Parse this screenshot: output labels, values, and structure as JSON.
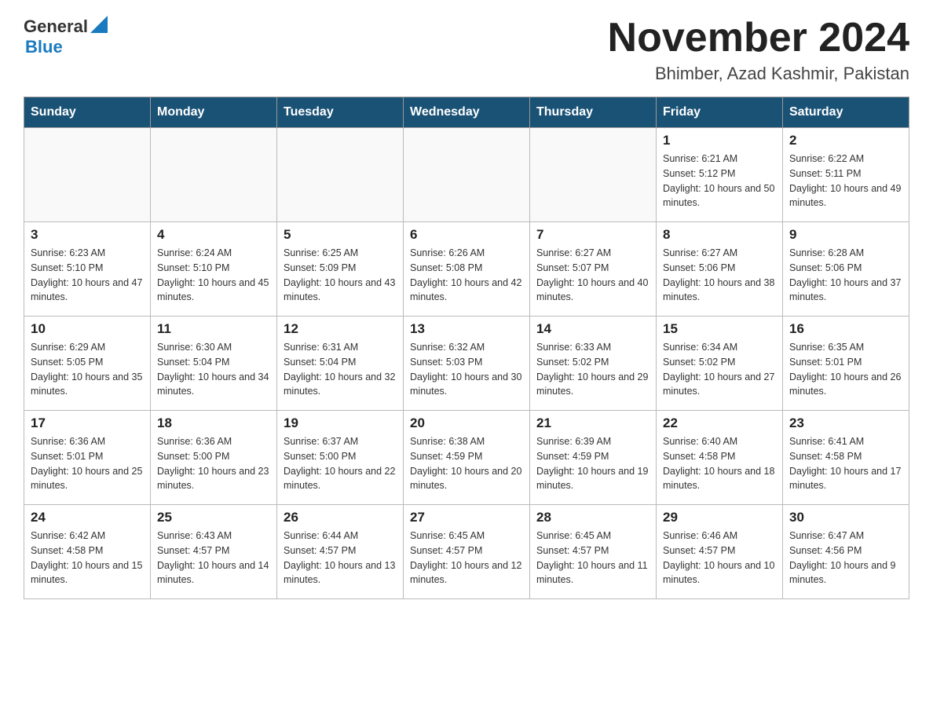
{
  "header": {
    "logo": {
      "general": "General",
      "blue": "Blue"
    },
    "title": "November 2024",
    "subtitle": "Bhimber, Azad Kashmir, Pakistan"
  },
  "days_of_week": [
    "Sunday",
    "Monday",
    "Tuesday",
    "Wednesday",
    "Thursday",
    "Friday",
    "Saturday"
  ],
  "weeks": [
    [
      {
        "day": "",
        "info": ""
      },
      {
        "day": "",
        "info": ""
      },
      {
        "day": "",
        "info": ""
      },
      {
        "day": "",
        "info": ""
      },
      {
        "day": "",
        "info": ""
      },
      {
        "day": "1",
        "info": "Sunrise: 6:21 AM\nSunset: 5:12 PM\nDaylight: 10 hours and 50 minutes."
      },
      {
        "day": "2",
        "info": "Sunrise: 6:22 AM\nSunset: 5:11 PM\nDaylight: 10 hours and 49 minutes."
      }
    ],
    [
      {
        "day": "3",
        "info": "Sunrise: 6:23 AM\nSunset: 5:10 PM\nDaylight: 10 hours and 47 minutes."
      },
      {
        "day": "4",
        "info": "Sunrise: 6:24 AM\nSunset: 5:10 PM\nDaylight: 10 hours and 45 minutes."
      },
      {
        "day": "5",
        "info": "Sunrise: 6:25 AM\nSunset: 5:09 PM\nDaylight: 10 hours and 43 minutes."
      },
      {
        "day": "6",
        "info": "Sunrise: 6:26 AM\nSunset: 5:08 PM\nDaylight: 10 hours and 42 minutes."
      },
      {
        "day": "7",
        "info": "Sunrise: 6:27 AM\nSunset: 5:07 PM\nDaylight: 10 hours and 40 minutes."
      },
      {
        "day": "8",
        "info": "Sunrise: 6:27 AM\nSunset: 5:06 PM\nDaylight: 10 hours and 38 minutes."
      },
      {
        "day": "9",
        "info": "Sunrise: 6:28 AM\nSunset: 5:06 PM\nDaylight: 10 hours and 37 minutes."
      }
    ],
    [
      {
        "day": "10",
        "info": "Sunrise: 6:29 AM\nSunset: 5:05 PM\nDaylight: 10 hours and 35 minutes."
      },
      {
        "day": "11",
        "info": "Sunrise: 6:30 AM\nSunset: 5:04 PM\nDaylight: 10 hours and 34 minutes."
      },
      {
        "day": "12",
        "info": "Sunrise: 6:31 AM\nSunset: 5:04 PM\nDaylight: 10 hours and 32 minutes."
      },
      {
        "day": "13",
        "info": "Sunrise: 6:32 AM\nSunset: 5:03 PM\nDaylight: 10 hours and 30 minutes."
      },
      {
        "day": "14",
        "info": "Sunrise: 6:33 AM\nSunset: 5:02 PM\nDaylight: 10 hours and 29 minutes."
      },
      {
        "day": "15",
        "info": "Sunrise: 6:34 AM\nSunset: 5:02 PM\nDaylight: 10 hours and 27 minutes."
      },
      {
        "day": "16",
        "info": "Sunrise: 6:35 AM\nSunset: 5:01 PM\nDaylight: 10 hours and 26 minutes."
      }
    ],
    [
      {
        "day": "17",
        "info": "Sunrise: 6:36 AM\nSunset: 5:01 PM\nDaylight: 10 hours and 25 minutes."
      },
      {
        "day": "18",
        "info": "Sunrise: 6:36 AM\nSunset: 5:00 PM\nDaylight: 10 hours and 23 minutes."
      },
      {
        "day": "19",
        "info": "Sunrise: 6:37 AM\nSunset: 5:00 PM\nDaylight: 10 hours and 22 minutes."
      },
      {
        "day": "20",
        "info": "Sunrise: 6:38 AM\nSunset: 4:59 PM\nDaylight: 10 hours and 20 minutes."
      },
      {
        "day": "21",
        "info": "Sunrise: 6:39 AM\nSunset: 4:59 PM\nDaylight: 10 hours and 19 minutes."
      },
      {
        "day": "22",
        "info": "Sunrise: 6:40 AM\nSunset: 4:58 PM\nDaylight: 10 hours and 18 minutes."
      },
      {
        "day": "23",
        "info": "Sunrise: 6:41 AM\nSunset: 4:58 PM\nDaylight: 10 hours and 17 minutes."
      }
    ],
    [
      {
        "day": "24",
        "info": "Sunrise: 6:42 AM\nSunset: 4:58 PM\nDaylight: 10 hours and 15 minutes."
      },
      {
        "day": "25",
        "info": "Sunrise: 6:43 AM\nSunset: 4:57 PM\nDaylight: 10 hours and 14 minutes."
      },
      {
        "day": "26",
        "info": "Sunrise: 6:44 AM\nSunset: 4:57 PM\nDaylight: 10 hours and 13 minutes."
      },
      {
        "day": "27",
        "info": "Sunrise: 6:45 AM\nSunset: 4:57 PM\nDaylight: 10 hours and 12 minutes."
      },
      {
        "day": "28",
        "info": "Sunrise: 6:45 AM\nSunset: 4:57 PM\nDaylight: 10 hours and 11 minutes."
      },
      {
        "day": "29",
        "info": "Sunrise: 6:46 AM\nSunset: 4:57 PM\nDaylight: 10 hours and 10 minutes."
      },
      {
        "day": "30",
        "info": "Sunrise: 6:47 AM\nSunset: 4:56 PM\nDaylight: 10 hours and 9 minutes."
      }
    ]
  ]
}
